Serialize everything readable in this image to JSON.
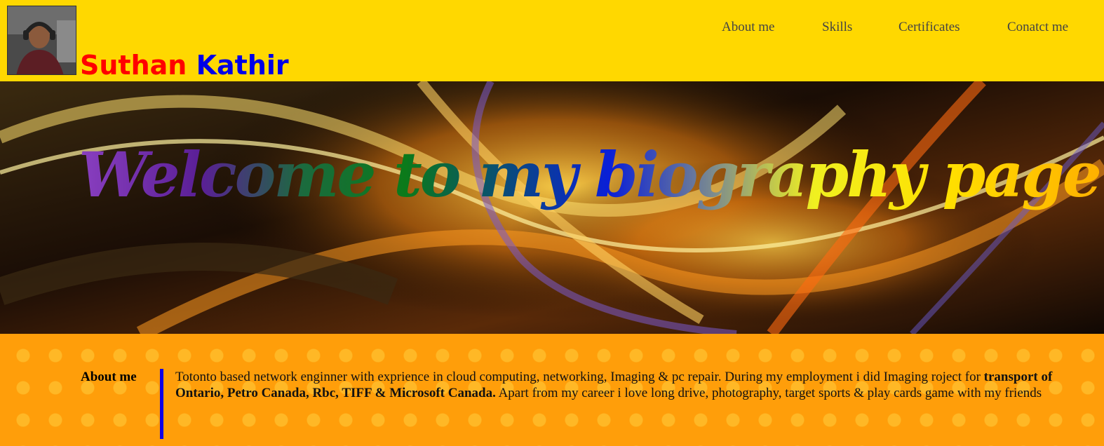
{
  "header": {
    "first_name": "Suthan",
    "last_name": "Kathir",
    "nav": [
      {
        "label": "About me"
      },
      {
        "label": "Skills"
      },
      {
        "label": "Certificates"
      },
      {
        "label": "Conatct me"
      }
    ]
  },
  "hero": {
    "title": "Welcome to my biography page"
  },
  "about": {
    "heading": "About me",
    "text_before": "Totonto based network enginner with exprience in cloud computing, networking, Imaging & pc repair. During my employment i did Imaging roject for ",
    "text_bold": "transport of Ontario, Petro Canada, Rbc, TIFF & Microsoft Canada.",
    "text_after": " Apart from my career i love long drive, photography, target sports & play cards game with my friends"
  },
  "colors": {
    "header_bg": "#ffd800",
    "first_name": "#ff0000",
    "last_name": "#0000e6",
    "about_bg": "#ff9e0a",
    "about_rule": "#1100e6"
  },
  "icons": {
    "avatar": "profile-photo"
  }
}
